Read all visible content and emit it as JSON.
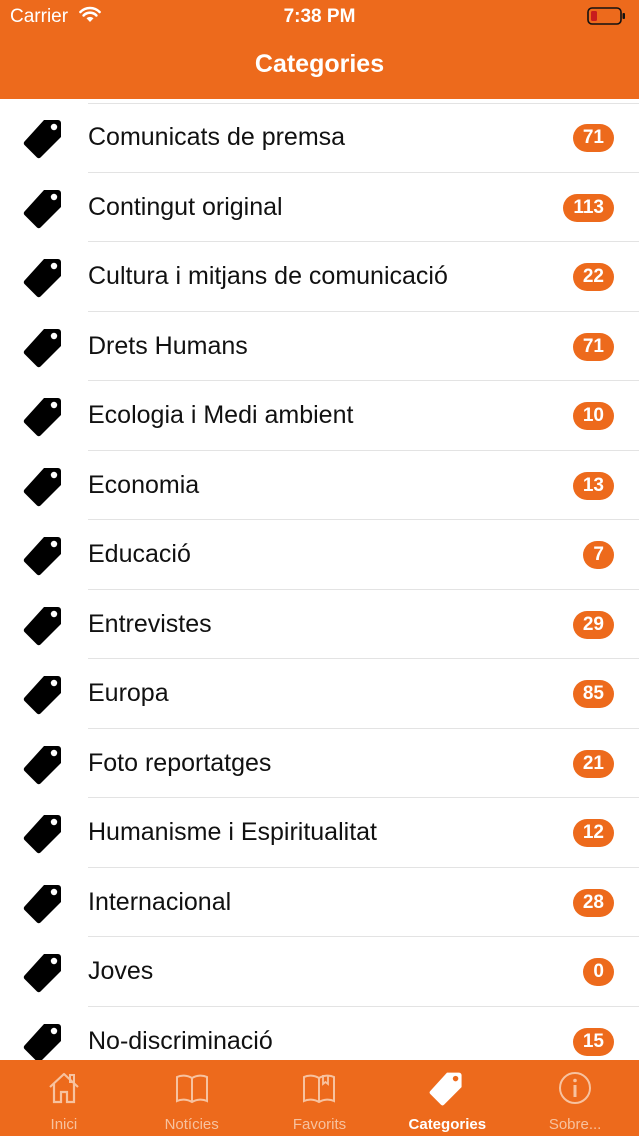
{
  "status_bar": {
    "carrier": "Carrier",
    "time": "7:38 PM"
  },
  "header": {
    "title": "Categories"
  },
  "categories": [
    {
      "label": "Comunicats de premsa",
      "count": "71"
    },
    {
      "label": "Contingut original",
      "count": "113"
    },
    {
      "label": "Cultura i mitjans de comunicació",
      "count": "22"
    },
    {
      "label": "Drets Humans",
      "count": "71"
    },
    {
      "label": "Ecologia i Medi ambient",
      "count": "10"
    },
    {
      "label": "Economia",
      "count": "13"
    },
    {
      "label": "Educació",
      "count": "7"
    },
    {
      "label": "Entrevistes",
      "count": "29"
    },
    {
      "label": "Europa",
      "count": "85"
    },
    {
      "label": "Foto reportatges",
      "count": "21"
    },
    {
      "label": "Humanisme i Espiritualitat",
      "count": "12"
    },
    {
      "label": "Internacional",
      "count": "28"
    },
    {
      "label": "Joves",
      "count": "0"
    },
    {
      "label": "No-discriminació",
      "count": "15"
    }
  ],
  "tab_bar": {
    "tabs": [
      {
        "label": "Inici",
        "icon": "home-icon"
      },
      {
        "label": "Notícies",
        "icon": "book-icon"
      },
      {
        "label": "Favorits",
        "icon": "bookmarked-book-icon"
      },
      {
        "label": "Categories",
        "icon": "tag-icon"
      },
      {
        "label": "Sobre...",
        "icon": "info-icon"
      }
    ],
    "active": "Categories"
  },
  "colors": {
    "accent": "#ed6a1c",
    "inactive_tab": "#f7c29f",
    "separator": "#e3e3e3"
  }
}
